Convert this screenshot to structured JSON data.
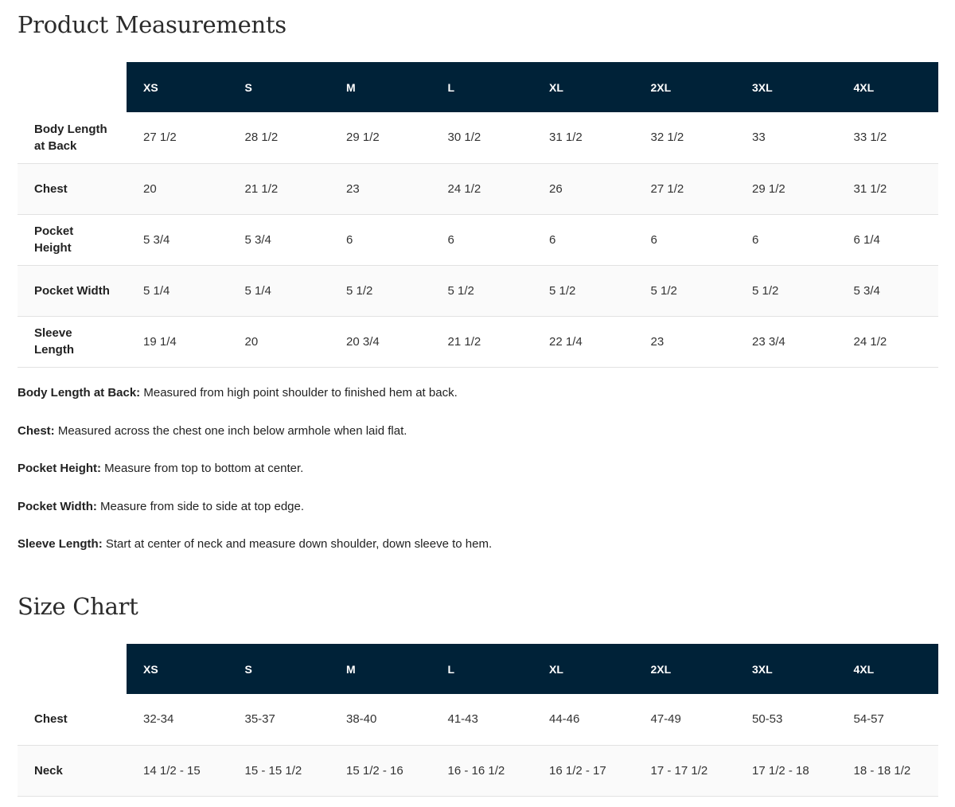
{
  "measurements": {
    "title": "Product Measurements",
    "sizes": [
      "XS",
      "S",
      "M",
      "L",
      "XL",
      "2XL",
      "3XL",
      "4XL"
    ],
    "rows": [
      {
        "label_line1": "Body Length",
        "label_line2": "at Back",
        "values": [
          "27 1/2",
          "28 1/2",
          "29 1/2",
          "30 1/2",
          "31 1/2",
          "32 1/2",
          "33",
          "33 1/2"
        ]
      },
      {
        "label_line1": "Chest",
        "label_line2": "",
        "values": [
          "20",
          "21 1/2",
          "23",
          "24 1/2",
          "26",
          "27 1/2",
          "29 1/2",
          "31 1/2"
        ]
      },
      {
        "label_line1": "Pocket",
        "label_line2": "Height",
        "values": [
          "5 3/4",
          "5 3/4",
          "6",
          "6",
          "6",
          "6",
          "6",
          "6 1/4"
        ]
      },
      {
        "label_line1": "Pocket Width",
        "label_line2": "",
        "values": [
          "5 1/4",
          "5 1/4",
          "5 1/2",
          "5 1/2",
          "5 1/2",
          "5 1/2",
          "5 1/2",
          "5 3/4"
        ]
      },
      {
        "label_line1": "Sleeve",
        "label_line2": "Length",
        "values": [
          "19 1/4",
          "20",
          "20 3/4",
          "21 1/2",
          "22 1/4",
          "23",
          "23 3/4",
          "24 1/2"
        ]
      }
    ],
    "notes": [
      {
        "term": "Body Length at Back:",
        "text": " Measured from high point shoulder to finished hem at back."
      },
      {
        "term": "Chest:",
        "text": " Measured across the chest one inch below armhole when laid flat."
      },
      {
        "term": "Pocket Height:",
        "text": " Measure from top to bottom at center."
      },
      {
        "term": "Pocket Width:",
        "text": " Measure from side to side at top edge."
      },
      {
        "term": "Sleeve Length:",
        "text": " Start at center of neck and measure down shoulder, down sleeve to hem."
      }
    ]
  },
  "size_chart": {
    "title": "Size Chart",
    "sizes": [
      "XS",
      "S",
      "M",
      "L",
      "XL",
      "2XL",
      "3XL",
      "4XL"
    ],
    "rows": [
      {
        "label": "Chest",
        "values": [
          "32-34",
          "35-37",
          "38-40",
          "41-43",
          "44-46",
          "47-49",
          "50-53",
          "54-57"
        ]
      },
      {
        "label": "Neck",
        "values": [
          "14 1/2 - 15",
          "15 - 15 1/2",
          "15 1/2 - 16",
          "16 - 16 1/2",
          "16 1/2 - 17",
          "17 - 17 1/2",
          "17 1/2 - 18",
          "18 - 18 1/2"
        ]
      }
    ]
  },
  "colors": {
    "header_bg": "#002238",
    "header_text": "#ffffff",
    "row_alt_bg": "#fafafa",
    "divider": "#e2e2e2"
  }
}
